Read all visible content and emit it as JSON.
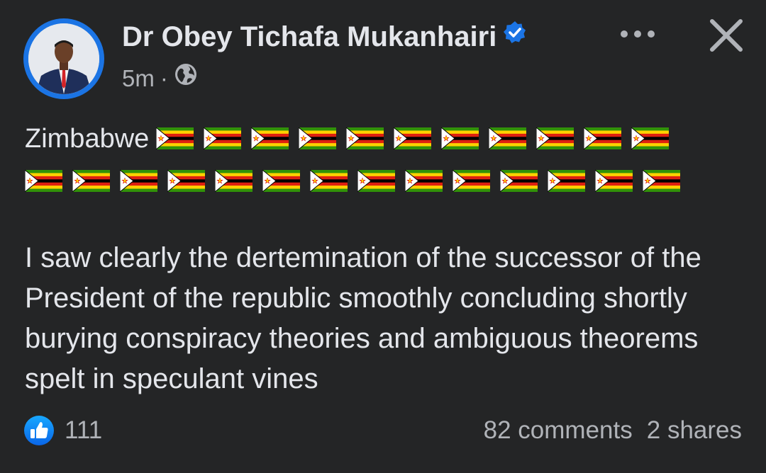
{
  "author": {
    "name": "Dr Obey Tichafa Mukanhairi",
    "avatar_icon": "profile-photo",
    "verified_icon": "verified-badge-icon",
    "verified_color": "#1b74e4"
  },
  "meta": {
    "time": "5m",
    "separator": "·",
    "audience_icon": "globe-icon"
  },
  "actions": {
    "more_icon": "more-icon",
    "close_icon": "close-icon"
  },
  "post": {
    "headline": "Zimbabwe",
    "flag_icon": "zimbabwe-flag-emoji",
    "flags_line1": 11,
    "flags_line2": 14,
    "body": "I saw clearly the dertemination of the successor of the President of the republic smoothly concluding shortly burying conspiracy theories and ambiguous theorems spelt in speculant vines"
  },
  "stats": {
    "like_icon": "like-icon",
    "likes": "111",
    "comments": "82 comments",
    "shares": "2 shares"
  },
  "colors": {
    "background": "#242526",
    "text": "#e4e6eb",
    "secondary": "#b0b3b8",
    "accent": "#1b74e4"
  }
}
